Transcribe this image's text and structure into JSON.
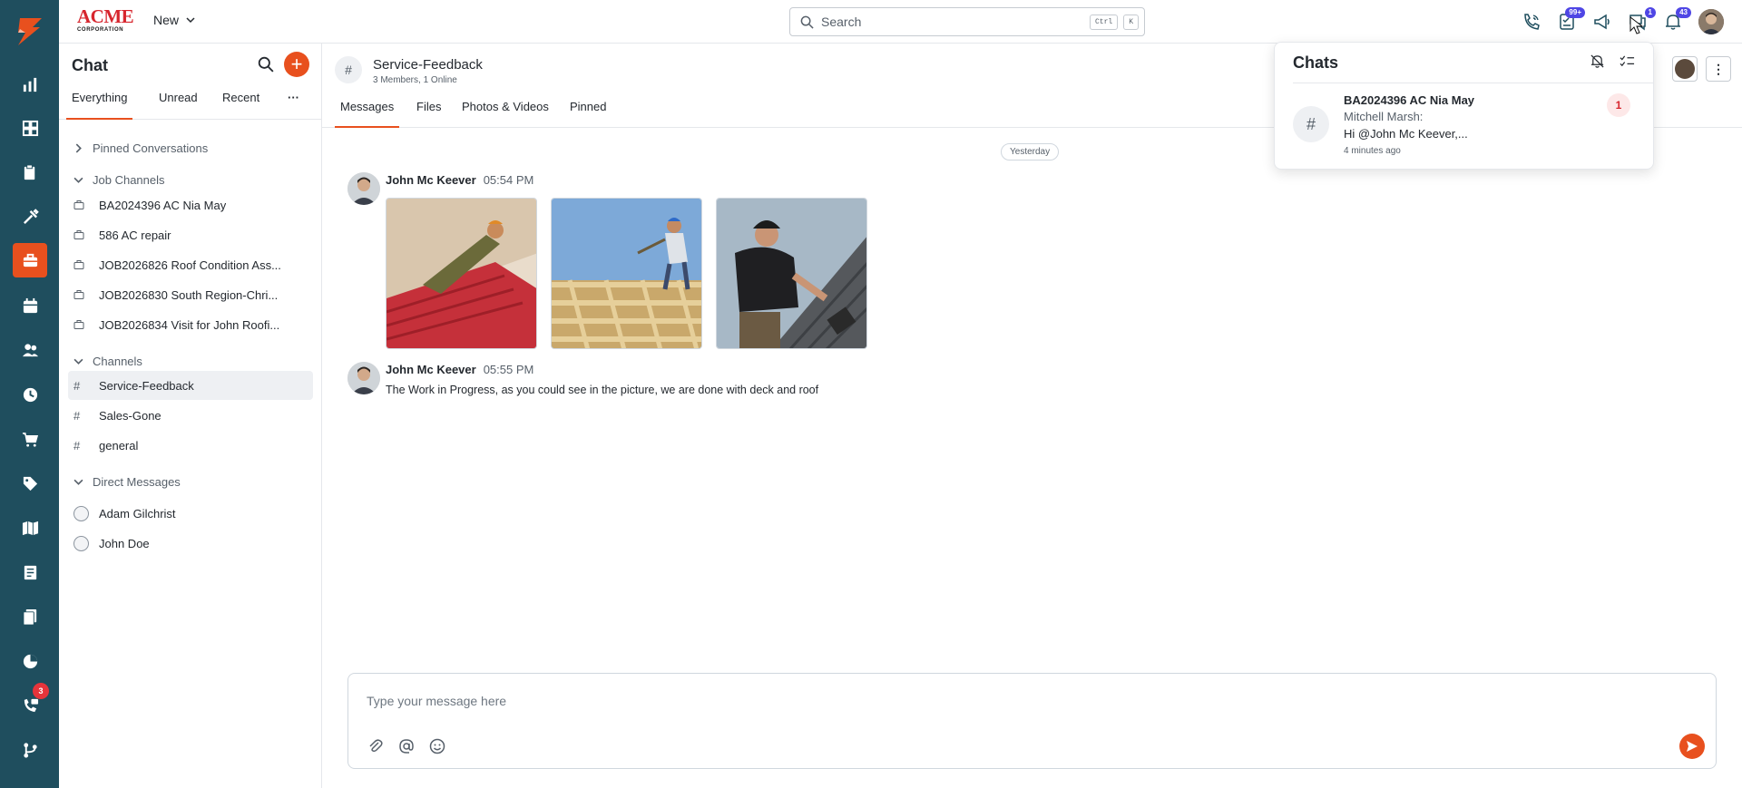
{
  "brand": {
    "logo_main": "ACME",
    "logo_sub": "CORPORATION",
    "accent": "#e8501e",
    "rail_bg": "#1f4e5e"
  },
  "rail": {
    "items": [
      {
        "icon": "dashboard-chart-icon"
      },
      {
        "icon": "grid-icon"
      },
      {
        "icon": "clipboard-icon"
      },
      {
        "icon": "tools-icon"
      },
      {
        "icon": "briefcase-icon",
        "active": true
      },
      {
        "icon": "calendar-icon"
      },
      {
        "icon": "people-icon"
      },
      {
        "icon": "clock-icon"
      },
      {
        "icon": "cart-icon"
      },
      {
        "icon": "tag-icon"
      },
      {
        "icon": "map-icon"
      },
      {
        "icon": "invoice-icon"
      },
      {
        "icon": "documents-icon"
      },
      {
        "icon": "pie-chart-icon"
      },
      {
        "icon": "phone-chat-icon",
        "badge": "3"
      },
      {
        "icon": "branch-icon"
      }
    ]
  },
  "topbar": {
    "new_label": "New",
    "search_placeholder": "Search",
    "search_kbd1": "Ctrl",
    "search_kbd2": "K",
    "badges": {
      "tasks": "99+",
      "chats": "1",
      "notifications": "43"
    }
  },
  "sidebar": {
    "title": "Chat",
    "tabs": [
      "Everything",
      "Unread",
      "Recent"
    ],
    "more_label": "···",
    "pinned_label": "Pinned Conversations",
    "job_label": "Job Channels",
    "jobs": [
      "BA2024396 AC Nia May",
      "586 AC repair",
      "JOB2026826 Roof Condition Ass...",
      "JOB2026830 South Region-Chri...",
      "JOB2026834 Visit for John Roofi..."
    ],
    "channels_label": "Channels",
    "channels": [
      "Service-Feedback",
      "Sales-Gone",
      "general"
    ],
    "dm_label": "Direct Messages",
    "dms": [
      "Adam Gilchrist",
      "John Doe"
    ]
  },
  "channel": {
    "name": "Service-Feedback",
    "subtitle": "3 Members, 1 Online",
    "tabs": [
      "Messages",
      "Files",
      "Photos & Videos",
      "Pinned"
    ],
    "day_divider": "Yesterday",
    "messages": [
      {
        "author": "John Mc Keever",
        "time": "05:54 PM",
        "text": ""
      },
      {
        "author": "John Mc Keever",
        "time": "05:55 PM",
        "text": "The Work in Progress, as you could see in the picture, we are done with deck and roof"
      }
    ],
    "composer_placeholder": "Type your message here"
  },
  "popup": {
    "title": "Chats",
    "item": {
      "name": "BA2024396 AC Nia May",
      "author": "Mitchell Marsh:",
      "snippet": "Hi @John Mc Keever,...",
      "time": "4 minutes ago",
      "count": "1"
    }
  }
}
